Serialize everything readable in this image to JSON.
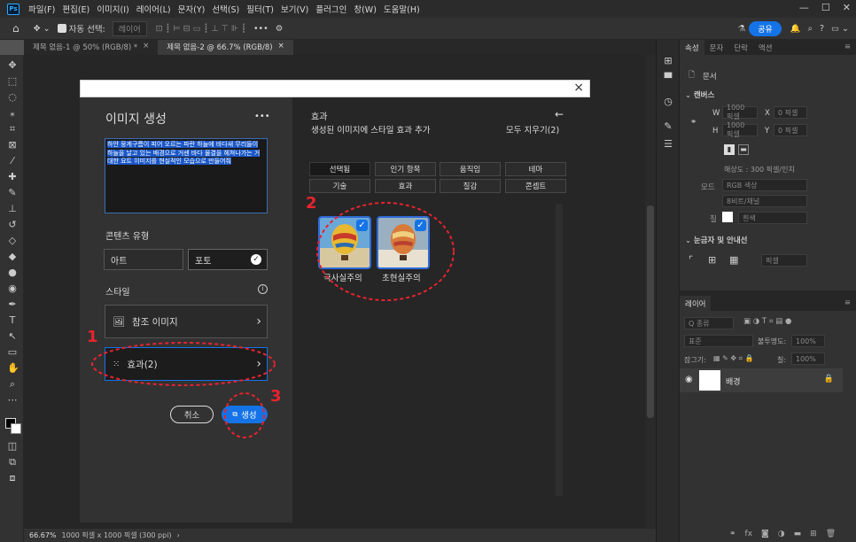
{
  "app": {
    "logo": "Ps"
  },
  "menu": [
    "파일(F)",
    "편집(E)",
    "이미지(I)",
    "레이어(L)",
    "문자(Y)",
    "선택(S)",
    "필터(T)",
    "보기(V)",
    "플러그인",
    "창(W)",
    "도움말(H)"
  ],
  "options_bar": {
    "auto_select_label": "자동 선택:",
    "auto_select_value": "레이어",
    "more": "•••",
    "share": "공유"
  },
  "doc_tabs": [
    {
      "label": "제목 없음-1 @ 50% (RGB/8) *",
      "close": "×"
    },
    {
      "label": "제목 없음-2 @ 66.7% (RGB/8)",
      "close": "×"
    }
  ],
  "status": {
    "zoom": "66.67%",
    "info": "1000 픽셀 x 1000 픽셀 (300 ppi)"
  },
  "dialog": {
    "close": "×",
    "title": "이미지 생성",
    "more": "•••",
    "prompt": "하얀 뭉게구름이 피어 오르는 파란 하늘에 바다새 무리들이 하늘을 날고 있는 배경으로 거센 바다 물결을 헤쳐나가는 거대한 요트 이미지를 현실적인 모습으로 만들어줘",
    "content_type_label": "콘텐츠 유형",
    "content_types": [
      "아트",
      "포토"
    ],
    "style_label": "스타일",
    "ref_image_label": "참조 이미지",
    "effects_label": "효과(2)",
    "cancel": "취소",
    "generate": "생성",
    "right_title": "효과",
    "right_subtitle": "생성된 이미지에 스타일 효과 추가",
    "clear_all": "모두 지우기(2)",
    "chips_row1": [
      "선택됨",
      "인기 항목",
      "움직임",
      "테마"
    ],
    "chips_row2": [
      "기술",
      "효과",
      "질감",
      "콘셉트"
    ],
    "thumbs": [
      {
        "label": "극사실주의"
      },
      {
        "label": "초현실주의"
      }
    ],
    "annotations": [
      "1",
      "2",
      "3"
    ]
  },
  "properties": {
    "tabs": [
      "속성",
      "문자",
      "단락",
      "액션"
    ],
    "doc_label": "문서",
    "canvas_section": "캔버스",
    "w_label": "W",
    "w_value": "1000 픽셀",
    "x_label": "X",
    "x_value": "0 픽셀",
    "h_label": "H",
    "h_value": "1000 픽셀",
    "y_label": "Y",
    "y_value": "0 픽셀",
    "resolution": "해상도 : 300 픽셀/인치",
    "mode_label": "모드",
    "mode_value": "RGB 색상",
    "bit_value": "8비트/채널",
    "fill_label": "칠",
    "fill_value": "흰색",
    "guides_section": "눈금자 및 안내선",
    "units_value": "픽셀"
  },
  "layers": {
    "tab": "레이어",
    "filter_value": "Q 종류",
    "blend_value": "표준",
    "opacity_label": "불투명도:",
    "opacity_value": "100%",
    "lock_label": "잠그기:",
    "fill_label": "칠:",
    "fill_value": "100%",
    "layer_name": "배경"
  },
  "colors": {
    "accent": "#1473e6",
    "annotation": "#e8232e"
  }
}
